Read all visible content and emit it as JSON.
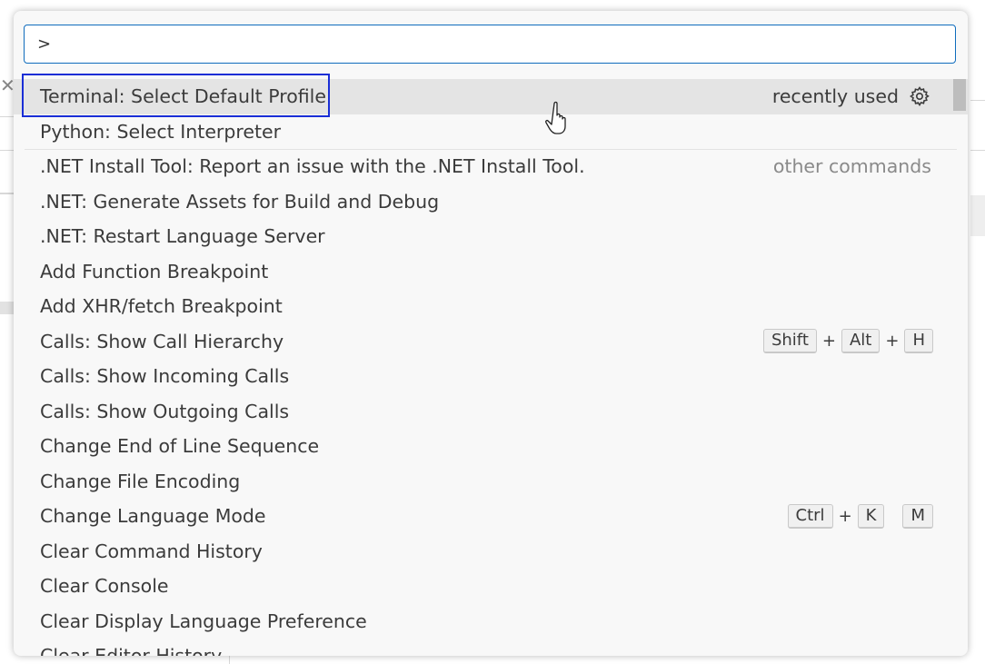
{
  "command_palette": {
    "input_value": ">",
    "input_placeholder": "",
    "items": [
      {
        "label": "Terminal: Select Default Profile",
        "group": "recently used",
        "selected": true,
        "has_gear": true
      },
      {
        "label": "Python: Select Interpreter"
      },
      {
        "label": ".NET Install Tool: Report an issue with the .NET Install Tool.",
        "group": "other commands",
        "muted_group": true,
        "separator": true
      },
      {
        "label": ".NET: Generate Assets for Build and Debug"
      },
      {
        "label": ".NET: Restart Language Server"
      },
      {
        "label": "Add Function Breakpoint"
      },
      {
        "label": "Add XHR/fetch Breakpoint"
      },
      {
        "label": "Calls: Show Call Hierarchy",
        "keys": [
          "Shift",
          "+",
          "Alt",
          "+",
          "H"
        ]
      },
      {
        "label": "Calls: Show Incoming Calls"
      },
      {
        "label": "Calls: Show Outgoing Calls"
      },
      {
        "label": "Change End of Line Sequence"
      },
      {
        "label": "Change File Encoding"
      },
      {
        "label": "Change Language Mode",
        "keys": [
          "Ctrl",
          "+",
          "K",
          " ",
          "M"
        ]
      },
      {
        "label": "Clear Command History"
      },
      {
        "label": "Clear Console"
      },
      {
        "label": "Clear Display Language Preference"
      },
      {
        "label": "Clear Editor History"
      }
    ]
  },
  "colors": {
    "focus_border": "#1a2ed6",
    "input_border": "#0f6cbd",
    "selected_bg": "#e4e4e4"
  },
  "icons": {
    "gear": "gear-icon",
    "close": "close-icon",
    "cursor": "hand-pointer-icon"
  }
}
